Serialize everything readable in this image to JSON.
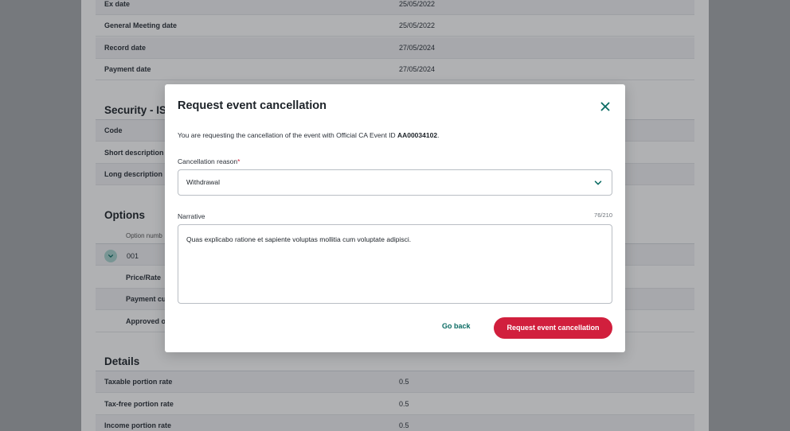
{
  "background": {
    "top_rows": [
      {
        "label": "Ex date",
        "value": "25/05/2022"
      },
      {
        "label": "General Meeting date",
        "value": "25/05/2022"
      },
      {
        "label": "Record date",
        "value": "27/05/2024"
      },
      {
        "label": "Payment date",
        "value": "27/05/2024"
      }
    ],
    "security": {
      "title": "Security - ISI",
      "rows": [
        {
          "label": "Code"
        },
        {
          "label": "Short description"
        },
        {
          "label": "Long description"
        }
      ]
    },
    "options": {
      "title": "Options",
      "header": "Option numb",
      "option_value": "001",
      "rows": [
        {
          "label": "Price/Rate"
        },
        {
          "label": "Payment cu"
        },
        {
          "label": "Approved o"
        }
      ]
    },
    "details": {
      "title": "Details",
      "rows": [
        {
          "label": "Taxable portion rate",
          "value": "0.5"
        },
        {
          "label": "Tax-free portion rate",
          "value": "0.5"
        },
        {
          "label": "Income portion rate",
          "value": "0.5"
        }
      ]
    }
  },
  "modal": {
    "title": "Request event cancellation",
    "description_prefix": "You are requesting the cancellation of the event with Official CA Event ID ",
    "event_id": "AA00034102",
    "description_suffix": ".",
    "reason_label": "Cancellation reason",
    "required_mark": "*",
    "reason_value": "Withdrawal",
    "narrative_label": "Narrative",
    "narrative_counter": "76/210",
    "narrative_value": "Quas explicabo ratione et sapiente voluptas mollitia cum voluptate adipisci.",
    "go_back_label": "Go back",
    "submit_label": "Request event cancellation"
  },
  "colors": {
    "accent": "#0a6b63",
    "primary_button": "#d11f3d"
  },
  "icons": {
    "close": "close-icon",
    "dropdown": "chevron-down-icon",
    "option_toggle": "chevron-down-icon"
  }
}
